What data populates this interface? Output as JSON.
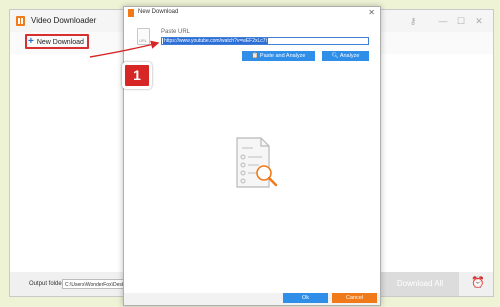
{
  "app": {
    "title": "Video Downloader",
    "new_download_label": "New Download",
    "output_folder_label": "Output folder:",
    "output_folder_value": "C:\\Users\\WonderFox\\Desktop",
    "download_all_label": "Download All"
  },
  "dialog": {
    "title": "New Download",
    "paste_url_label": "Paste URL",
    "url_value": "https://www.youtube.com/watch?v=wEF2xLc7t",
    "file_icon_text": "URL",
    "paste_analyze_label": "Paste and Analyze",
    "analyze_label": "Analyze",
    "ok_label": "Ok",
    "cancel_label": "Cancel"
  },
  "annotation": {
    "step_number": "1",
    "color": "#d62626"
  },
  "colors": {
    "accent_blue": "#2f8ee8",
    "accent_orange": "#f07a1a"
  },
  "icons": [
    "app-logo-icon",
    "plus-icon",
    "minimize-icon",
    "maximize-icon",
    "close-icon",
    "alarm-clock-icon",
    "file-url-icon",
    "paste-icon",
    "search-icon",
    "empty-list-search-icon"
  ]
}
